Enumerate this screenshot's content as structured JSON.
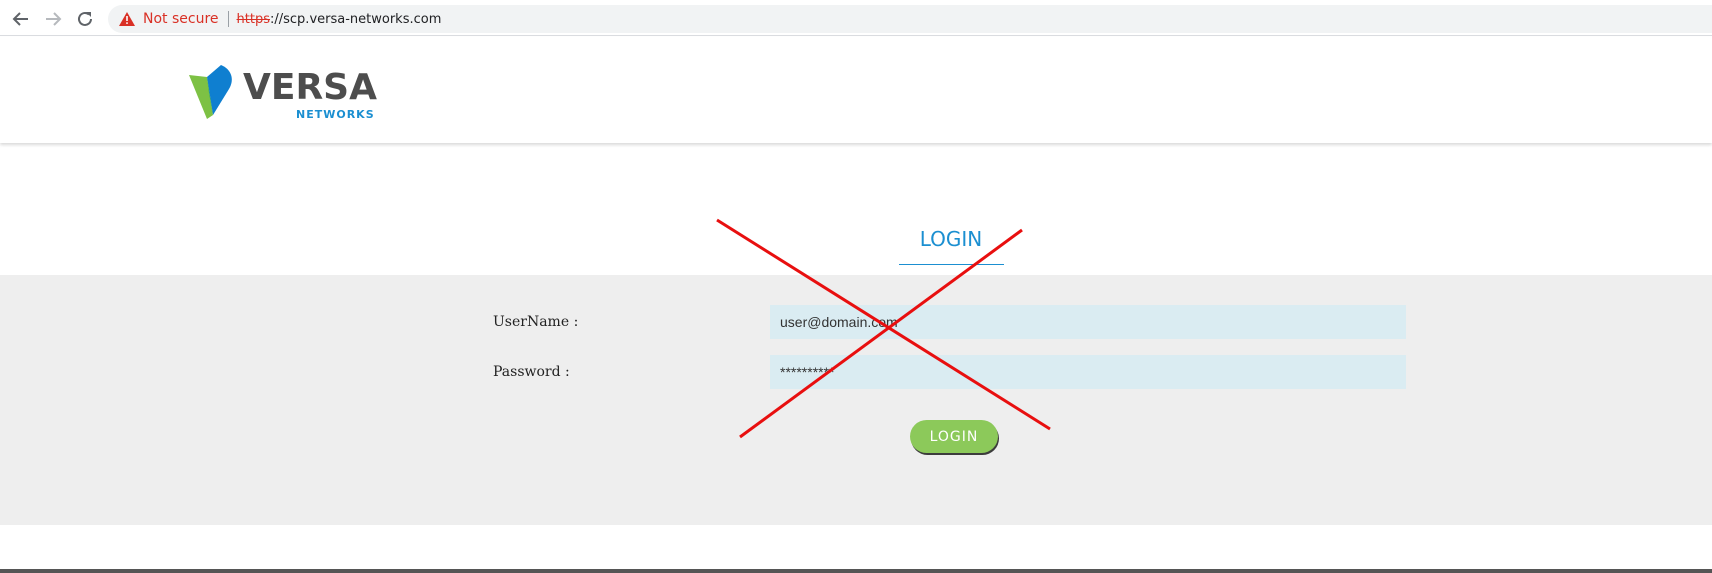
{
  "browser": {
    "security_label": "Not secure",
    "url_scheme": "https",
    "url_rest": "://scp.versa-networks.com",
    "warning_color": "#d93025"
  },
  "logo": {
    "main_text": "VERSA",
    "sub_text": "NETWORKS",
    "main_color": "#4d4d4d",
    "sub_color": "#1b8fd1",
    "mark_green": "#7dc144",
    "mark_blue": "#0f7fd0"
  },
  "login": {
    "heading": "LOGIN",
    "heading_color": "#1b8fd1",
    "username_label": "UserName :",
    "username_value": "user@domain.com",
    "password_label": "Password :",
    "password_value": "**********",
    "button_label": "LOGIN",
    "button_color": "#8cc95a"
  },
  "annotation": {
    "cross_color": "#e80f0f"
  },
  "icons": {
    "back": "arrow-left-icon",
    "forward": "arrow-right-icon",
    "reload": "reload-icon",
    "security": "warning-triangle-icon"
  }
}
